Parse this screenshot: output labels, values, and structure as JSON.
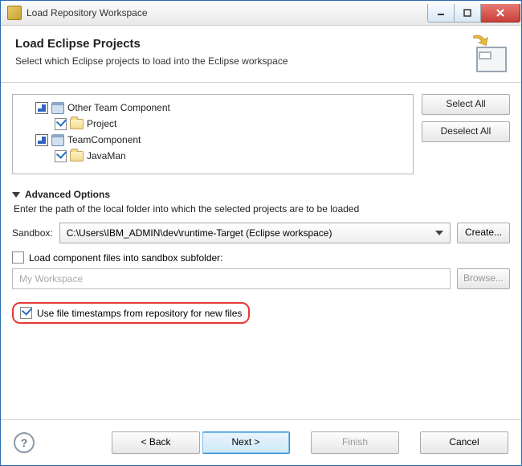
{
  "window": {
    "title": "Load Repository Workspace"
  },
  "header": {
    "title": "Load Eclipse Projects",
    "subtitle": "Select which Eclipse projects to load into the Eclipse workspace"
  },
  "tree": {
    "components": [
      {
        "name": "Other Team Component",
        "project": "Project"
      },
      {
        "name": "TeamComponent",
        "project": "JavaMan"
      }
    ]
  },
  "side_buttons": {
    "select_all": "Select All",
    "deselect_all": "Deselect All"
  },
  "advanced": {
    "title": "Advanced Options",
    "desc": "Enter the path of the local folder into which the selected projects are to be loaded",
    "sandbox_label": "Sandbox:",
    "sandbox_value": "C:\\Users\\IBM_ADMIN\\dev\\runtime-Target (Eclipse workspace)",
    "create_btn": "Create...",
    "load_subfolder_label": "Load component files into sandbox subfolder:",
    "subfolder_placeholder": "My Workspace",
    "browse_btn": "Browse...",
    "timestamps_label": "Use file timestamps from repository for new files"
  },
  "footer": {
    "back": "< Back",
    "next": "Next >",
    "finish": "Finish",
    "cancel": "Cancel",
    "help": "?"
  }
}
